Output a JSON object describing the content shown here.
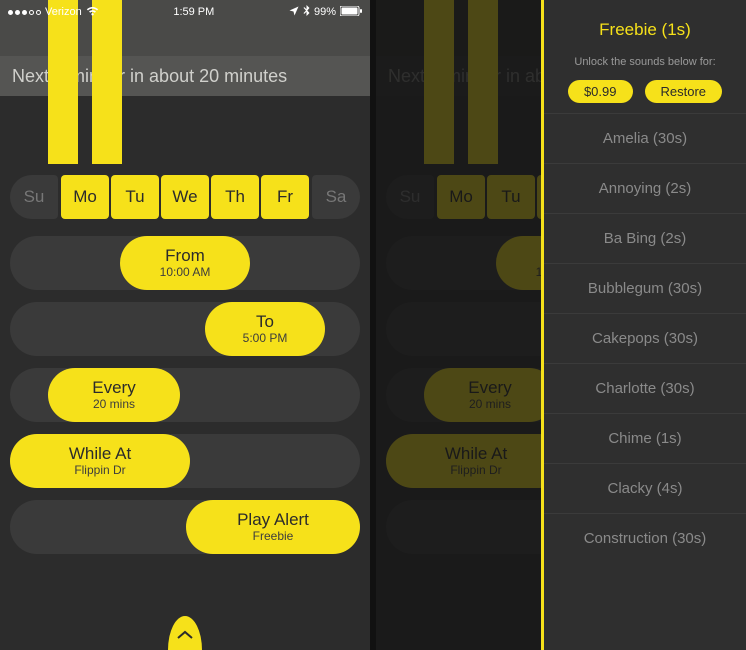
{
  "status": {
    "carrier": "Verizon",
    "time": "1:59 PM",
    "battery": "99%"
  },
  "reminder_text": "Next reminder in about 20 minutes",
  "days": [
    "Su",
    "Mo",
    "Tu",
    "We",
    "Th",
    "Fr",
    "Sa"
  ],
  "days_active": [
    false,
    true,
    true,
    true,
    true,
    true,
    false
  ],
  "pills": {
    "from": {
      "title": "From",
      "sub": "10:00 AM"
    },
    "to": {
      "title": "To",
      "sub": "5:00 PM"
    },
    "every": {
      "title": "Every",
      "sub": "20 mins"
    },
    "while": {
      "title": "While At",
      "sub": "Flippin Dr"
    },
    "alert": {
      "title": "Play Alert",
      "sub": "Freebie"
    }
  },
  "panel": {
    "title": "Freebie (1s)",
    "subtitle": "Unlock the sounds below for:",
    "price_label": "$0.99",
    "restore_label": "Restore",
    "sounds": [
      "Amelia (30s)",
      "Annoying (2s)",
      "Ba Bing (2s)",
      "Bubblegum (30s)",
      "Cakepops (30s)",
      "Charlotte (30s)",
      "Chime (1s)",
      "Clacky (4s)",
      "Construction (30s)"
    ]
  }
}
